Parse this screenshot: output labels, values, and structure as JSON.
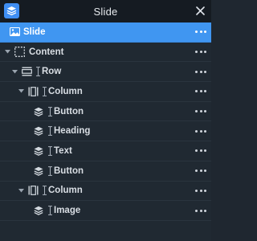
{
  "window": {
    "title": "Slide"
  },
  "tree": [
    {
      "label": "Slide"
    },
    {
      "label": "Content"
    },
    {
      "label": "Row"
    },
    {
      "label": "Column"
    },
    {
      "label": "Button"
    },
    {
      "label": "Heading"
    },
    {
      "label": "Text"
    },
    {
      "label": "Button"
    },
    {
      "label": "Column"
    },
    {
      "label": "Image"
    }
  ]
}
